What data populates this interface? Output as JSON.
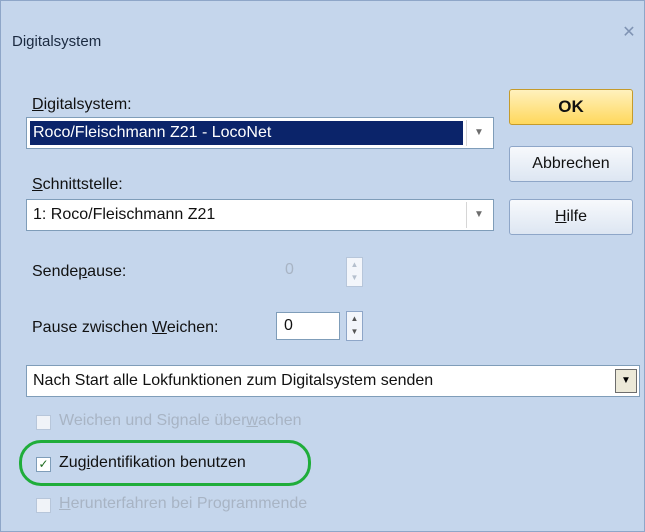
{
  "window": {
    "title": "Digitalsystem",
    "close_glyph": "✕"
  },
  "digitalsystem": {
    "label_access": "D",
    "label_rest": "igitalsystem:",
    "value": "Roco/Fleischmann Z21 - LocoNet"
  },
  "schnittstelle": {
    "label_access": "S",
    "label_rest": "chnittstelle:",
    "value": "1: Roco/Fleischmann Z21"
  },
  "sendepause": {
    "label_pre": "Sende",
    "label_access": "p",
    "label_post": "ause:",
    "value": "0"
  },
  "weichenpause": {
    "label_pre": "Pause zwischen ",
    "label_access": "W",
    "label_post": "eichen:",
    "value": "0"
  },
  "start_option": {
    "value": "Nach Start alle Lokfunktionen zum Digitalsystem senden"
  },
  "buttons": {
    "ok": "OK",
    "cancel": "Abbrechen",
    "help_access": "H",
    "help_rest": "ilfe"
  },
  "checkboxes": {
    "weichen": {
      "pre": "Weichen und Signale über",
      "access": "w",
      "post": "achen",
      "checked": false,
      "enabled": false
    },
    "zugid": {
      "pre": "Zug",
      "access": "i",
      "post": "dentifikation benutzen",
      "checked": true,
      "enabled": true
    },
    "herunter": {
      "pre": "",
      "access": "H",
      "post": "erunterfahren bei Programmende",
      "checked": false,
      "enabled": false
    }
  },
  "glyphs": {
    "dropdown_arrow": "▼",
    "spin_up": "▲",
    "spin_down": "▼",
    "checkmark": "✓"
  },
  "colors": {
    "dialog_bg": "#c5d6ec",
    "selection": "#0b246a",
    "ok_button": "#ffd85c",
    "annotation_green": "#1fad3a"
  }
}
